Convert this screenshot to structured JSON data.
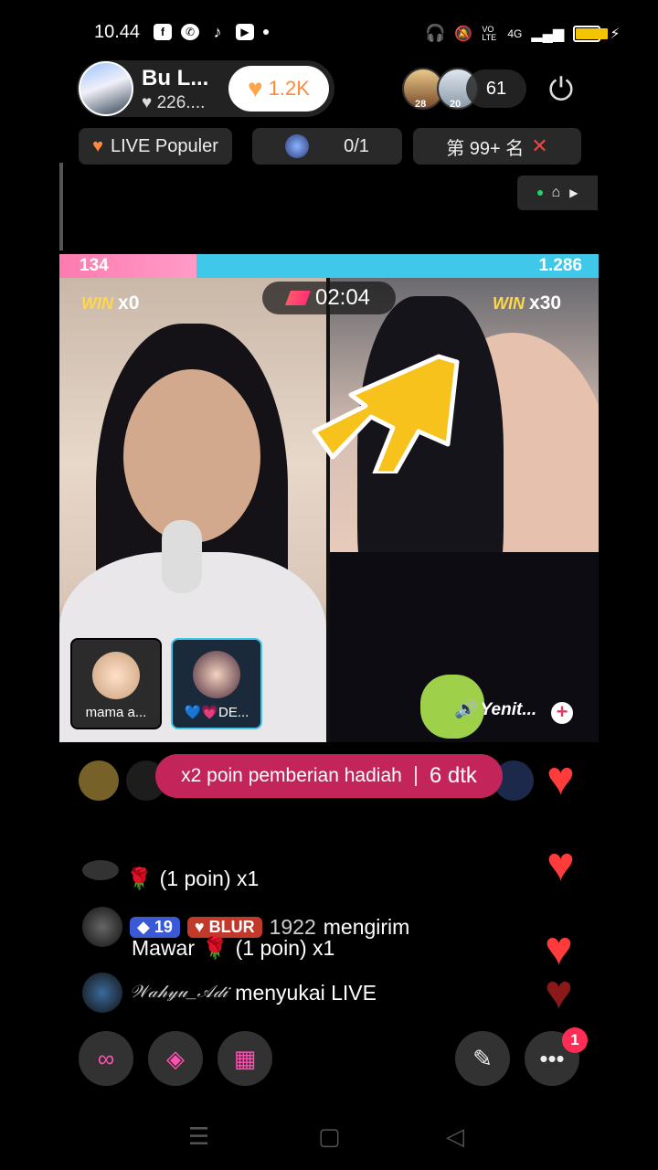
{
  "status_bar": {
    "time": "10.44",
    "left_icons": [
      "facebook-icon",
      "whatsapp-icon",
      "tiktok-icon",
      "youtube-icon"
    ],
    "right_icons": [
      "headphones-icon",
      "mute-icon",
      "volte-icon",
      "signal-icon",
      "battery-icon"
    ],
    "network": "4G",
    "volte": "VO LTE"
  },
  "host": {
    "name": "Bu L...",
    "likes": "226....",
    "like_count": "1.2K"
  },
  "viewers": {
    "badges": [
      "28",
      "20"
    ],
    "count": "61"
  },
  "chips": {
    "live_popular": "LIVE Populer",
    "match_progress": "0/1",
    "rank": "第 99+ 名"
  },
  "battle": {
    "score_left": "134",
    "score_right": "1.286",
    "score_left_share": 0.094,
    "timer": "02:04",
    "win_label": "WIN",
    "win_left": "x0",
    "win_right": "x30",
    "cohosts": [
      {
        "name": "mama a..."
      },
      {
        "name": "💙💗DE..."
      }
    ],
    "sound_label": "Yenit..."
  },
  "bonus_banner": {
    "text": "x2 poin pemberian hadiah",
    "countdown": "6 dtk"
  },
  "chat": {
    "line1": "(1 poin) x1",
    "line2_level": "19",
    "line2_fan": "BLUR",
    "line2_user": "1922",
    "line2_action": "mengirim",
    "line3": "Mawar",
    "line3_tail": "(1 poin) x1",
    "line4_user": "𝒲𝒶𝒽𝓎𝓊_𝒜𝒹𝒾",
    "line4_action": "menyukai LIVE"
  },
  "bottom_bar": {
    "notification_count": "1"
  },
  "colors": {
    "accent_pink": "#c3255b",
    "score_blue": "#3fc8ea",
    "score_pink": "#ff7bb0",
    "heart_red": "#ff3b3b",
    "win_yellow": "#ffd84a"
  }
}
